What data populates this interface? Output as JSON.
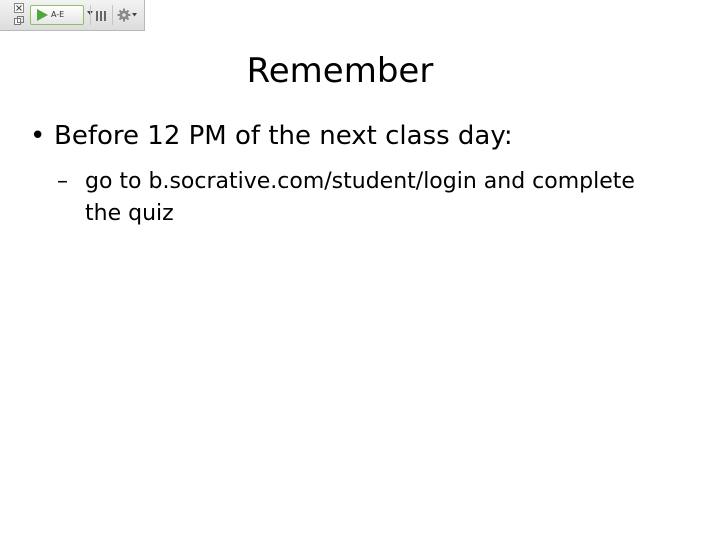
{
  "toolbar": {
    "range_label": "A-E",
    "icons": [
      "close-icon",
      "restore-icon",
      "play-icon",
      "chevron-down-icon",
      "bar-chart-icon",
      "gear-icon"
    ],
    "colors": {
      "accent_green": "#4fa83d",
      "border_green": "#8fbf63"
    }
  },
  "slide": {
    "title": "Remember",
    "bullet_marker": "•",
    "bullet_text": "Before 12 PM of the next class day:",
    "sub_marker": "–",
    "sub_text": "go to b.socrative.com/student/login and complete the quiz"
  }
}
